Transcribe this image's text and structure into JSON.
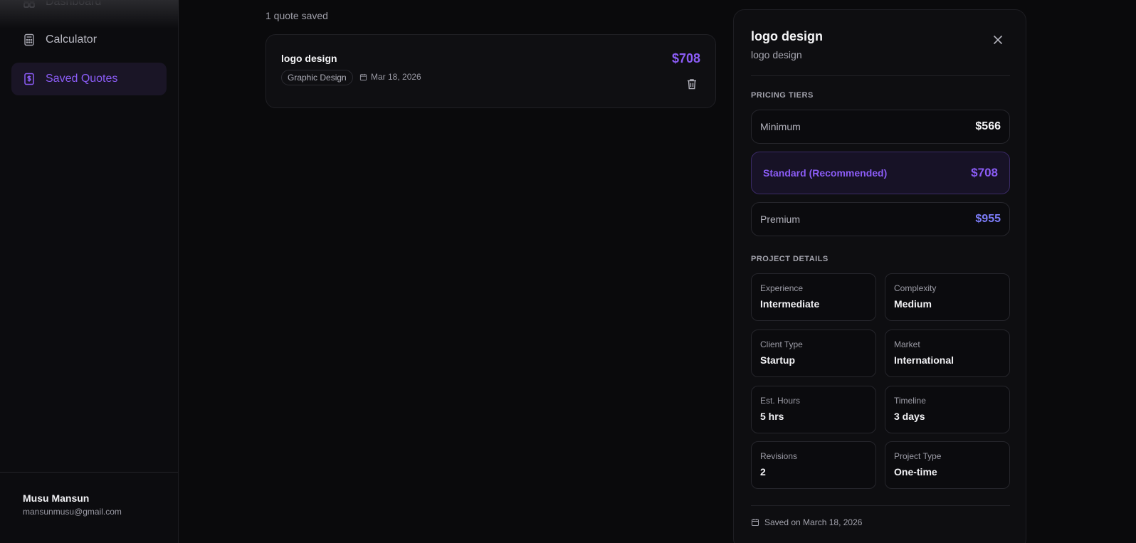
{
  "sidebar": {
    "items": [
      {
        "label": "Dashboard",
        "icon": "dashboard-icon"
      },
      {
        "label": "Calculator",
        "icon": "calculator-icon"
      },
      {
        "label": "Saved Quotes",
        "icon": "dollar-document-icon",
        "active": true
      }
    ],
    "user": {
      "name": "Musu Mansun",
      "email": "mansunmusu@gmail.com"
    }
  },
  "main": {
    "count_text": "1 quote saved",
    "quotes": [
      {
        "title": "logo design",
        "category": "Graphic Design",
        "date": "Mar 18, 2026",
        "price": "$708"
      }
    ]
  },
  "detail": {
    "title": "logo design",
    "subtitle": "logo design",
    "pricing_label": "PRICING TIERS",
    "tiers": [
      {
        "label": "Minimum",
        "price": "$566"
      },
      {
        "label": "Standard (Recommended)",
        "price": "$708"
      },
      {
        "label": "Premium",
        "price": "$955"
      }
    ],
    "details_label": "PROJECT DETAILS",
    "details": [
      {
        "label": "Experience",
        "value": "Intermediate"
      },
      {
        "label": "Complexity",
        "value": "Medium"
      },
      {
        "label": "Client Type",
        "value": "Startup"
      },
      {
        "label": "Market",
        "value": "International"
      },
      {
        "label": "Est. Hours",
        "value": "5 hrs"
      },
      {
        "label": "Timeline",
        "value": "3 days"
      },
      {
        "label": "Revisions",
        "value": "2"
      },
      {
        "label": "Project Type",
        "value": "One-time"
      }
    ],
    "saved_on": "Saved on March 18, 2026"
  },
  "colors": {
    "accent": "#8b5cf6",
    "premium": "#7c7cf8",
    "background": "#0a0a0c"
  }
}
